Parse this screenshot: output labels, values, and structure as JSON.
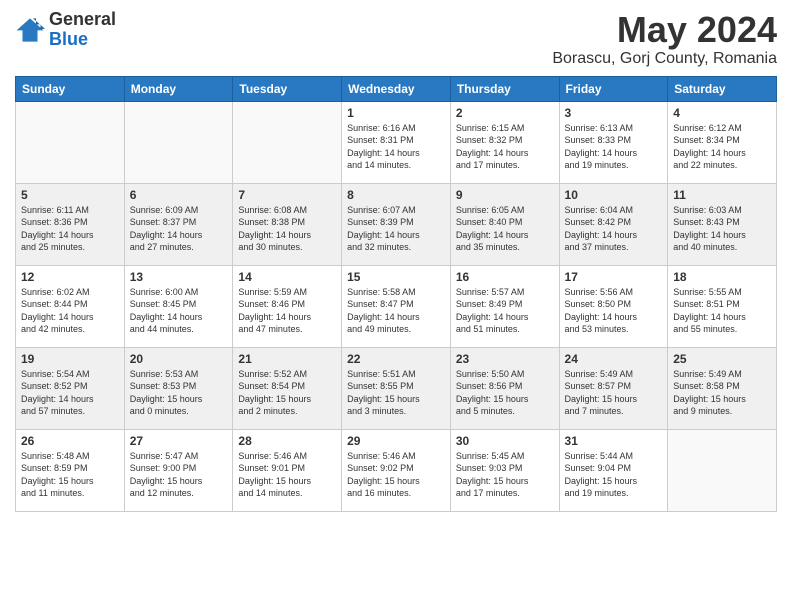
{
  "logo": {
    "general": "General",
    "blue": "Blue"
  },
  "title": "May 2024",
  "subtitle": "Borascu, Gorj County, Romania",
  "days_of_week": [
    "Sunday",
    "Monday",
    "Tuesday",
    "Wednesday",
    "Thursday",
    "Friday",
    "Saturday"
  ],
  "weeks": [
    [
      {
        "day": "",
        "info": ""
      },
      {
        "day": "",
        "info": ""
      },
      {
        "day": "",
        "info": ""
      },
      {
        "day": "1",
        "info": "Sunrise: 6:16 AM\nSunset: 8:31 PM\nDaylight: 14 hours\nand 14 minutes."
      },
      {
        "day": "2",
        "info": "Sunrise: 6:15 AM\nSunset: 8:32 PM\nDaylight: 14 hours\nand 17 minutes."
      },
      {
        "day": "3",
        "info": "Sunrise: 6:13 AM\nSunset: 8:33 PM\nDaylight: 14 hours\nand 19 minutes."
      },
      {
        "day": "4",
        "info": "Sunrise: 6:12 AM\nSunset: 8:34 PM\nDaylight: 14 hours\nand 22 minutes."
      }
    ],
    [
      {
        "day": "5",
        "info": "Sunrise: 6:11 AM\nSunset: 8:36 PM\nDaylight: 14 hours\nand 25 minutes."
      },
      {
        "day": "6",
        "info": "Sunrise: 6:09 AM\nSunset: 8:37 PM\nDaylight: 14 hours\nand 27 minutes."
      },
      {
        "day": "7",
        "info": "Sunrise: 6:08 AM\nSunset: 8:38 PM\nDaylight: 14 hours\nand 30 minutes."
      },
      {
        "day": "8",
        "info": "Sunrise: 6:07 AM\nSunset: 8:39 PM\nDaylight: 14 hours\nand 32 minutes."
      },
      {
        "day": "9",
        "info": "Sunrise: 6:05 AM\nSunset: 8:40 PM\nDaylight: 14 hours\nand 35 minutes."
      },
      {
        "day": "10",
        "info": "Sunrise: 6:04 AM\nSunset: 8:42 PM\nDaylight: 14 hours\nand 37 minutes."
      },
      {
        "day": "11",
        "info": "Sunrise: 6:03 AM\nSunset: 8:43 PM\nDaylight: 14 hours\nand 40 minutes."
      }
    ],
    [
      {
        "day": "12",
        "info": "Sunrise: 6:02 AM\nSunset: 8:44 PM\nDaylight: 14 hours\nand 42 minutes."
      },
      {
        "day": "13",
        "info": "Sunrise: 6:00 AM\nSunset: 8:45 PM\nDaylight: 14 hours\nand 44 minutes."
      },
      {
        "day": "14",
        "info": "Sunrise: 5:59 AM\nSunset: 8:46 PM\nDaylight: 14 hours\nand 47 minutes."
      },
      {
        "day": "15",
        "info": "Sunrise: 5:58 AM\nSunset: 8:47 PM\nDaylight: 14 hours\nand 49 minutes."
      },
      {
        "day": "16",
        "info": "Sunrise: 5:57 AM\nSunset: 8:49 PM\nDaylight: 14 hours\nand 51 minutes."
      },
      {
        "day": "17",
        "info": "Sunrise: 5:56 AM\nSunset: 8:50 PM\nDaylight: 14 hours\nand 53 minutes."
      },
      {
        "day": "18",
        "info": "Sunrise: 5:55 AM\nSunset: 8:51 PM\nDaylight: 14 hours\nand 55 minutes."
      }
    ],
    [
      {
        "day": "19",
        "info": "Sunrise: 5:54 AM\nSunset: 8:52 PM\nDaylight: 14 hours\nand 57 minutes."
      },
      {
        "day": "20",
        "info": "Sunrise: 5:53 AM\nSunset: 8:53 PM\nDaylight: 15 hours\nand 0 minutes."
      },
      {
        "day": "21",
        "info": "Sunrise: 5:52 AM\nSunset: 8:54 PM\nDaylight: 15 hours\nand 2 minutes."
      },
      {
        "day": "22",
        "info": "Sunrise: 5:51 AM\nSunset: 8:55 PM\nDaylight: 15 hours\nand 3 minutes."
      },
      {
        "day": "23",
        "info": "Sunrise: 5:50 AM\nSunset: 8:56 PM\nDaylight: 15 hours\nand 5 minutes."
      },
      {
        "day": "24",
        "info": "Sunrise: 5:49 AM\nSunset: 8:57 PM\nDaylight: 15 hours\nand 7 minutes."
      },
      {
        "day": "25",
        "info": "Sunrise: 5:49 AM\nSunset: 8:58 PM\nDaylight: 15 hours\nand 9 minutes."
      }
    ],
    [
      {
        "day": "26",
        "info": "Sunrise: 5:48 AM\nSunset: 8:59 PM\nDaylight: 15 hours\nand 11 minutes."
      },
      {
        "day": "27",
        "info": "Sunrise: 5:47 AM\nSunset: 9:00 PM\nDaylight: 15 hours\nand 12 minutes."
      },
      {
        "day": "28",
        "info": "Sunrise: 5:46 AM\nSunset: 9:01 PM\nDaylight: 15 hours\nand 14 minutes."
      },
      {
        "day": "29",
        "info": "Sunrise: 5:46 AM\nSunset: 9:02 PM\nDaylight: 15 hours\nand 16 minutes."
      },
      {
        "day": "30",
        "info": "Sunrise: 5:45 AM\nSunset: 9:03 PM\nDaylight: 15 hours\nand 17 minutes."
      },
      {
        "day": "31",
        "info": "Sunrise: 5:44 AM\nSunset: 9:04 PM\nDaylight: 15 hours\nand 19 minutes."
      },
      {
        "day": "",
        "info": ""
      }
    ]
  ],
  "colors": {
    "header_bg": "#2979c2",
    "accent": "#1a6fc4"
  }
}
